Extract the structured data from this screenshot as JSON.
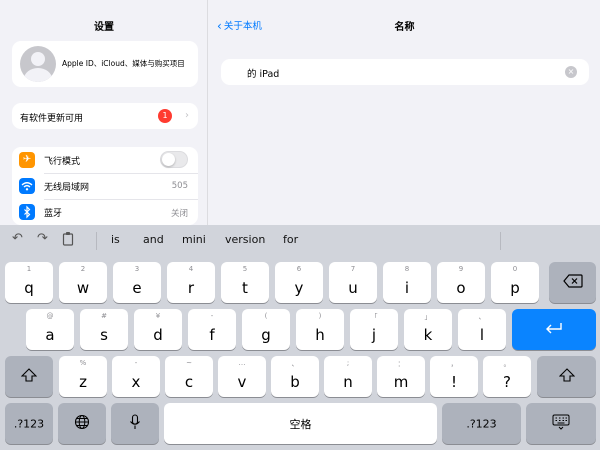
{
  "left": {
    "title": "设置",
    "profile_text": "Apple ID、iCloud、媒体与购买项目",
    "update_label": "有软件更新可用",
    "update_badge": "1",
    "rows": [
      {
        "label": "飞行模式",
        "value": "",
        "icon": "airplane-icon",
        "color": "#ff9500"
      },
      {
        "label": "无线局域网",
        "value": "505",
        "icon": "wifi-icon",
        "color": "#007aff"
      },
      {
        "label": "蓝牙",
        "value": "关闭",
        "icon": "bluetooth-icon",
        "color": "#007aff"
      }
    ]
  },
  "right": {
    "back_label": "关于本机",
    "title": "名称",
    "name_value": "的 iPad"
  },
  "keyboard": {
    "suggestions": [
      "is",
      "and",
      "mini",
      "version",
      "for"
    ],
    "row1": [
      {
        "main": "q",
        "alt": "1"
      },
      {
        "main": "w",
        "alt": "2"
      },
      {
        "main": "e",
        "alt": "3"
      },
      {
        "main": "r",
        "alt": "4"
      },
      {
        "main": "t",
        "alt": "5"
      },
      {
        "main": "y",
        "alt": "6"
      },
      {
        "main": "u",
        "alt": "7"
      },
      {
        "main": "i",
        "alt": "8"
      },
      {
        "main": "o",
        "alt": "9"
      },
      {
        "main": "p",
        "alt": "0"
      }
    ],
    "row2": [
      {
        "main": "a",
        "alt": "@"
      },
      {
        "main": "s",
        "alt": "#"
      },
      {
        "main": "d",
        "alt": "¥"
      },
      {
        "main": "f",
        "alt": "-"
      },
      {
        "main": "g",
        "alt": "("
      },
      {
        "main": "h",
        "alt": ")"
      },
      {
        "main": "j",
        "alt": "「"
      },
      {
        "main": "k",
        "alt": "」"
      },
      {
        "main": "l",
        "alt": "、"
      }
    ],
    "row3": [
      {
        "main": "z",
        "alt": "%"
      },
      {
        "main": "x",
        "alt": "-"
      },
      {
        "main": "c",
        "alt": "~"
      },
      {
        "main": "v",
        "alt": "…"
      },
      {
        "main": "b",
        "alt": "、"
      },
      {
        "main": "n",
        "alt": ";"
      },
      {
        "main": "m",
        "alt": "："
      },
      {
        "main": "!",
        "alt": "，"
      },
      {
        "main": "?",
        "alt": "。"
      }
    ],
    "numbers_label": ".?123",
    "space_label": "空格",
    "accent_color": "#0a84ff"
  }
}
